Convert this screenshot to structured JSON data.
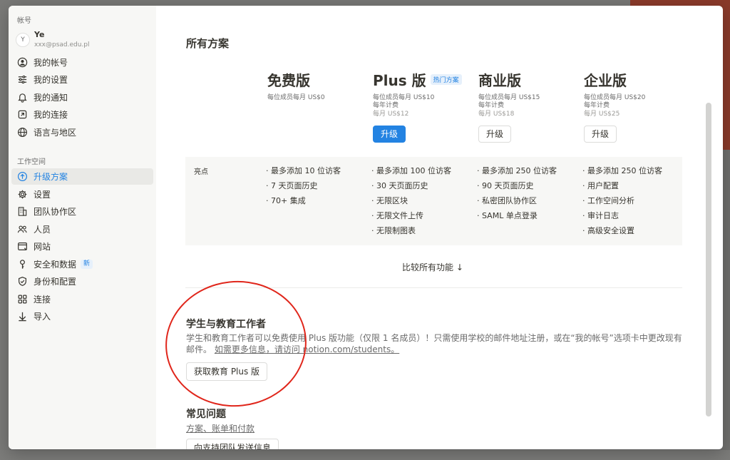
{
  "sidebar": {
    "account_section": "帐号",
    "account": {
      "avatar_initial": "Y",
      "name": "Ye",
      "email": "xxx@psad.edu.pl"
    },
    "account_items": [
      {
        "label": "我的帐号",
        "icon": "user-circle-icon"
      },
      {
        "label": "我的设置",
        "icon": "sliders-icon"
      },
      {
        "label": "我的通知",
        "icon": "bell-icon"
      },
      {
        "label": "我的连接",
        "icon": "external-link-icon"
      },
      {
        "label": "语言与地区",
        "icon": "globe-icon"
      }
    ],
    "workspace_section": "工作空间",
    "workspace_items": [
      {
        "label": "升级方案",
        "icon": "upgrade-circle-icon",
        "active": true
      },
      {
        "label": "设置",
        "icon": "gear-icon"
      },
      {
        "label": "团队协作区",
        "icon": "building-icon"
      },
      {
        "label": "人员",
        "icon": "people-icon"
      },
      {
        "label": "网站",
        "icon": "website-icon"
      },
      {
        "label": "安全和数据",
        "icon": "key-icon",
        "badge": "新"
      },
      {
        "label": "身份和配置",
        "icon": "shield-check-icon"
      },
      {
        "label": "连接",
        "icon": "grid-icon"
      },
      {
        "label": "导入",
        "icon": "arrow-down-icon"
      }
    ]
  },
  "main": {
    "all_plans_title": "所有方案",
    "plans": [
      {
        "name": "免费版",
        "price": "每位成员每月 US$0",
        "annual": "",
        "monthly": "",
        "button": ""
      },
      {
        "name": "Plus 版",
        "tag": "热门方案",
        "price": "每位成员每月 US$10",
        "annual": "每年计费",
        "monthly": "每月 US$12",
        "button": "升级"
      },
      {
        "name": "商业版",
        "price": "每位成员每月 US$15",
        "annual": "每年计费",
        "monthly": "每月 US$18",
        "button": "升级"
      },
      {
        "name": "企业版",
        "price": "每位成员每月 US$20",
        "annual": "每年计费",
        "monthly": "每月 US$25",
        "button": "升级"
      }
    ],
    "highlights_label": "亮点",
    "highlights": [
      [
        "· 最多添加 10 位访客",
        "· 7 天页面历史",
        "· 70+ 集成"
      ],
      [
        "· 最多添加 100 位访客",
        "· 30 天页面历史",
        "· 无限区块",
        "· 无限文件上传",
        "· 无限制图表"
      ],
      [
        "· 最多添加 250 位访客",
        "· 90 天页面历史",
        "· 私密团队协作区",
        "· SAML 单点登录"
      ],
      [
        "· 最多添加 250 位访客",
        "· 用户配置",
        "· 工作空间分析",
        "· 审计日志",
        "· 高级安全设置"
      ]
    ],
    "compare_all": "比较所有功能 ↓",
    "education": {
      "title": "学生与教育工作者",
      "desc": "学生和教育工作者可以免费使用 Plus 版功能（仅限 1 名成员）！只需使用学校的邮件地址注册，或在“我的帐号”选项卡中更改现有邮件。",
      "link": "如需更多信息，请访问 notion.com/students。",
      "button": "获取教育 Plus 版"
    },
    "faq": {
      "title": "常见问题",
      "link": "方案、账单和付款",
      "button": "向支持团队发送信息"
    }
  },
  "colors": {
    "accent": "#2383e2",
    "annotation": "#e0261b",
    "sidebar_bg": "#f7f7f5"
  }
}
